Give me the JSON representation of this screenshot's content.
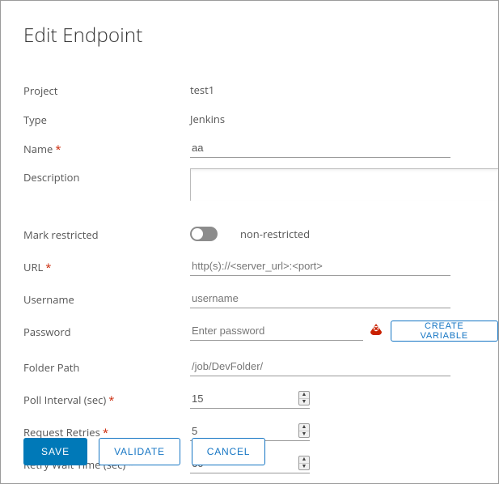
{
  "title": "Edit Endpoint",
  "labels": {
    "project": "Project",
    "type": "Type",
    "name": "Name",
    "description": "Description",
    "mark_restricted": "Mark restricted",
    "url": "URL",
    "username": "Username",
    "password": "Password",
    "folder_path": "Folder Path",
    "poll_interval": "Poll Interval (sec)",
    "request_retries": "Request Retries",
    "retry_wait": "Retry Wait Time (sec)"
  },
  "values": {
    "project": "test1",
    "type": "Jenkins",
    "name": "aa",
    "description": "",
    "restricted": false,
    "restricted_text": "non-restricted",
    "url": "",
    "username": "",
    "password": "",
    "folder_path": "",
    "poll_interval": "15",
    "request_retries": "5",
    "retry_wait": "60"
  },
  "placeholders": {
    "url": "http(s)://<server_url>:<port>",
    "username": "username",
    "password": "Enter password",
    "folder_path": "/job/DevFolder/"
  },
  "buttons": {
    "create_variable": "CREATE VARIABLE",
    "save": "SAVE",
    "validate": "VALIDATE",
    "cancel": "CANCEL"
  },
  "required_mark": "*"
}
